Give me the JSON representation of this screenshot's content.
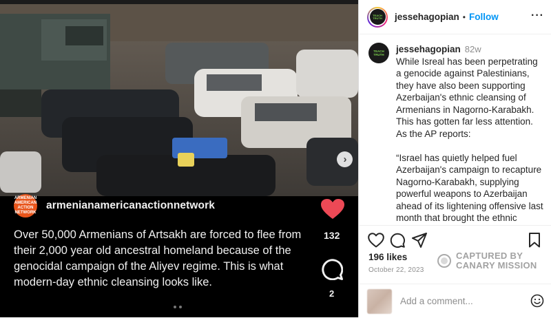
{
  "media": {
    "embed_user": "armenianamericanactionnetwork",
    "embed_avatar_text": "ARMENIAN AMERICAN ACTION NETWORK",
    "caption": "Over 50,000 Armenians of Artsakh are forced to flee from their 2,000 year old ancestral homeland because of the genocidal campaign of the Aliyev regime. This is what modern-day ethnic cleansing looks like.",
    "like_count": "132",
    "comment_count": "2",
    "next_icon": "chevron-right-icon"
  },
  "header": {
    "username": "jessehagopian",
    "dot": "•",
    "follow_label": "Follow",
    "avatar_text": "TEACH TRUTH",
    "more_label": "···"
  },
  "post": {
    "username": "jessehagopian",
    "time": "82w",
    "text": "While Isreal has been perpetrating a genocide against Palestinians, they have also been supporting Azerbaijan's ethnic cleansing of Armenians in Nagorno-Karabakh. This has gotten far less attention.\nAs the AP reports:\n\n“Israel has quietly helped fuel Azerbaijan's campaign to recapture Nagorno-Karabakh, supplying powerful weapons to Azerbaijan ahead of its lightening offensive last month that brought the ethnic Armenian enclave back under its control, officials and experts say...The fighting prompted over"
  },
  "stats": {
    "likes": "196 likes",
    "date": "October 22, 2023"
  },
  "watermark": {
    "line1": "CAPTURED BY",
    "line2": "CANARY MISSION"
  },
  "composer": {
    "placeholder": "Add a comment..."
  },
  "colors": {
    "follow": "#0095f6",
    "heart": "#ed4956",
    "embed_avatar": "#e8541a"
  }
}
